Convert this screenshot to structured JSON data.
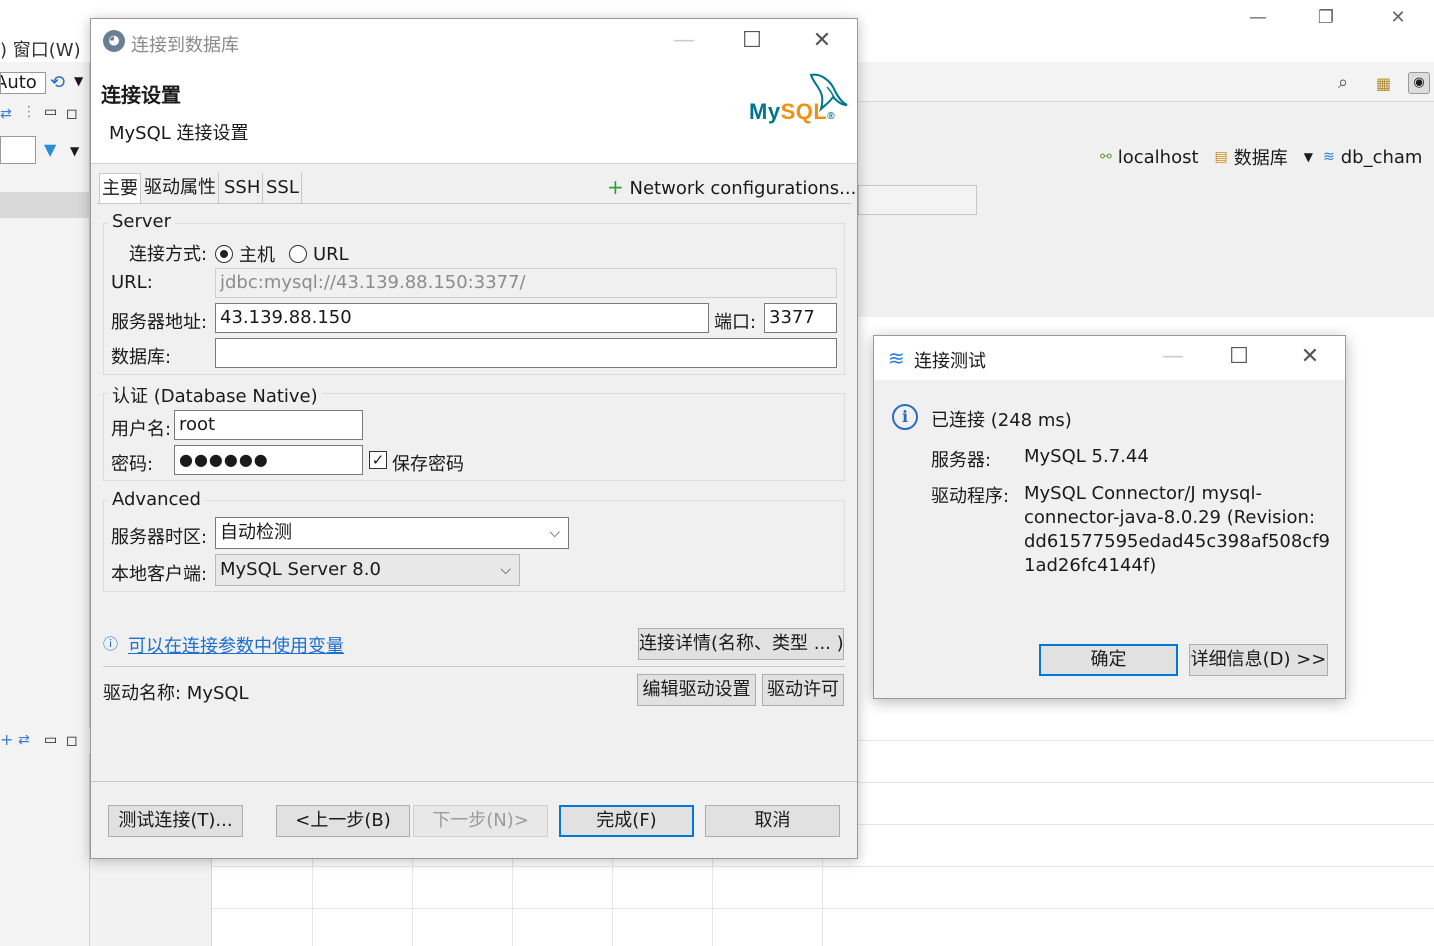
{
  "background_app": {
    "menu_partial": ") 窗口(W)",
    "toolbar_mode_value": "Auto",
    "breadcrumb": {
      "host": "localhost",
      "database_label": "数据库",
      "schema": "db_cham"
    }
  },
  "dialog": {
    "title": "连接到数据库",
    "heading": "连接设置",
    "subheading": "MySQL 连接设置",
    "logo_text": "MySQL",
    "tabs": [
      "主要",
      "驱动属性",
      "SSH",
      "SSL"
    ],
    "network_config": "Network configurations...",
    "server_group": {
      "title": "Server",
      "connect_method_label": "连接方式:",
      "option_host": "主机",
      "option_url": "URL",
      "url_label": "URL:",
      "url_value": "jdbc:mysql://43.139.88.150:3377/",
      "host_label": "服务器地址:",
      "host_value": "43.139.88.150",
      "port_label": "端口:",
      "port_value": "3377",
      "database_label": "数据库:",
      "database_value": ""
    },
    "auth_group": {
      "title": "认证 (Database Native)",
      "username_label": "用户名:",
      "username_value": "root",
      "password_label": "密码:",
      "password_value": "●●●●●●",
      "save_password_label": "保存密码",
      "save_password_checked": true
    },
    "advanced_group": {
      "title": "Advanced",
      "timezone_label": "服务器时区:",
      "timezone_value": "自动检测",
      "client_label": "本地客户端:",
      "client_value": "MySQL Server 8.0"
    },
    "variables_link": "可以在连接参数中使用变量",
    "details_button": "连接详情(名称、类型 ... )",
    "driver_name_label": "驱动名称: MySQL",
    "edit_driver_button": "编辑驱动设置",
    "driver_license_button": "驱动许可",
    "footer": {
      "test_button": "测试连接(T)...",
      "back_button": "<上一步(B)",
      "next_button": "下一步(N)>",
      "finish_button": "完成(F)",
      "cancel_button": "取消"
    }
  },
  "test_dialog": {
    "title": "连接测试",
    "status": "已连接 (248 ms)",
    "server_label": "服务器:",
    "server_value": "MySQL 5.7.44",
    "driver_label": "驱动程序:",
    "driver_value_lines": [
      "MySQL Connector/J mysql-",
      "connector-java-8.0.29 (Revision:",
      "dd61577595edad45c398af508cf9",
      "1ad26fc4144f)"
    ],
    "ok_button": "确定",
    "details_button": "详细信息(D) >>"
  },
  "colors": {
    "accent": "#0078d7",
    "link": "#1a6fd0",
    "mysql_blue": "#00758f",
    "mysql_orange": "#f29111",
    "info_blue": "#2a6cc1"
  }
}
